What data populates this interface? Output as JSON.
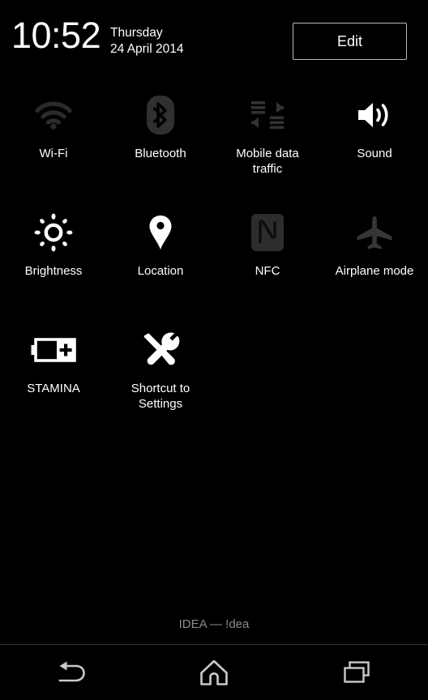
{
  "header": {
    "time": "10:52",
    "weekday": "Thursday",
    "date": "24 April 2014",
    "edit_label": "Edit"
  },
  "colors": {
    "background": "#000000",
    "icon_active": "#ffffff",
    "icon_inactive": "#2b2b2b",
    "icon_inactive_light": "#9a9a9a",
    "label": "#ffffff",
    "carrier_text": "#8a8a8a",
    "nav_icon": "#c9c9c9",
    "border": "#b9b9b9"
  },
  "tiles": [
    {
      "id": "wifi",
      "label": "Wi-Fi",
      "icon": "wifi-icon",
      "state": "off"
    },
    {
      "id": "bluetooth",
      "label": "Bluetooth",
      "icon": "bluetooth-icon",
      "state": "off"
    },
    {
      "id": "mobile-data",
      "label": "Mobile data\ntraffic",
      "icon": "mobile-data-icon",
      "state": "off"
    },
    {
      "id": "sound",
      "label": "Sound",
      "icon": "sound-icon",
      "state": "on"
    },
    {
      "id": "brightness",
      "label": "Brightness",
      "icon": "brightness-icon",
      "state": "on"
    },
    {
      "id": "location",
      "label": "Location",
      "icon": "location-pin-icon",
      "state": "on"
    },
    {
      "id": "nfc",
      "label": "NFC",
      "icon": "nfc-icon",
      "state": "off"
    },
    {
      "id": "airplane-mode",
      "label": "Airplane mode",
      "icon": "airplane-icon",
      "state": "off"
    },
    {
      "id": "stamina",
      "label": "STAMINA",
      "icon": "battery-plus-icon",
      "state": "on"
    },
    {
      "id": "shortcut-settings",
      "label": "Shortcut to\nSettings",
      "icon": "tools-icon",
      "state": "on"
    }
  ],
  "carrier": {
    "text": "IDEA — !dea"
  },
  "navbar": {
    "back_label": "Back",
    "home_label": "Home",
    "recents_label": "Recent apps"
  }
}
